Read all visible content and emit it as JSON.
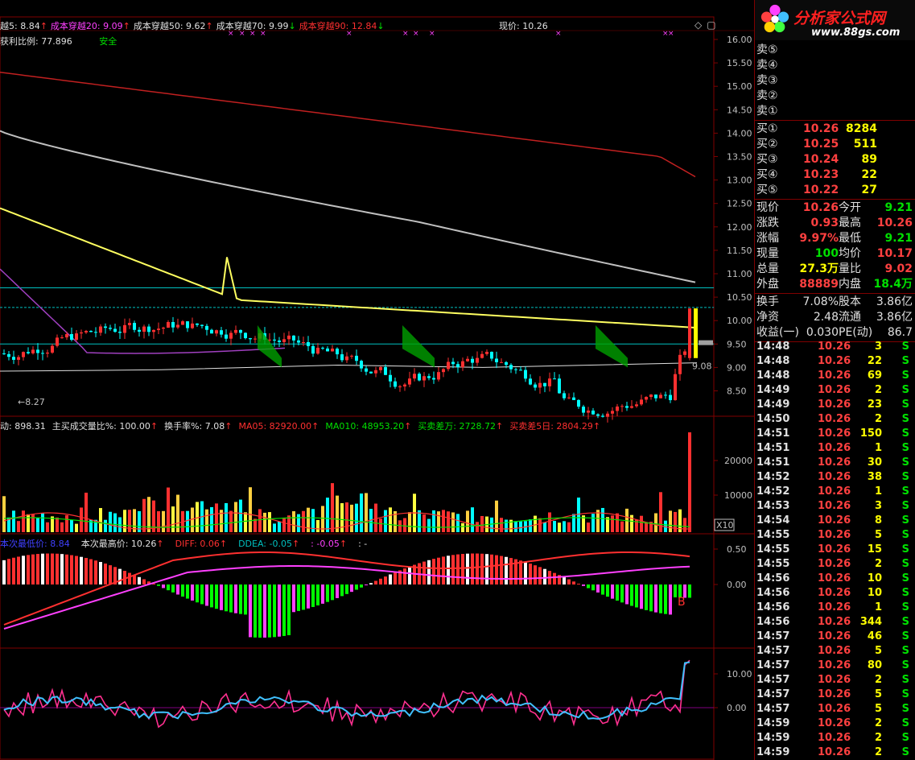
{
  "colors": {
    "bg": "#000000",
    "up": "#ff3030",
    "down": "#00ffff",
    "frame": "#800000",
    "yellow": "#ffff00",
    "green": "#00e000"
  },
  "main_header": {
    "items": [
      {
        "text": "越5: 8.84",
        "color": "#e0e0e0",
        "arrow": "↑",
        "arrow_color": "#ff3030"
      },
      {
        "text": "成本穿越20: 9.09",
        "color": "#ff40ff",
        "arrow": "↑",
        "arrow_color": "#ff3030"
      },
      {
        "text": "成本穿越50: 9.62",
        "color": "#e0e0e0",
        "arrow": "↑",
        "arrow_color": "#ff3030"
      },
      {
        "text": "成本穿越70: 9.99",
        "color": "#e0e0e0",
        "arrow": "↓",
        "arrow_color": "#00e000"
      },
      {
        "text": "成本穿越90: 12.84",
        "color": "#ff3030",
        "arrow": "↓",
        "arrow_color": "#00e000"
      }
    ],
    "current_price": "现价: 10.26",
    "profit_ratio": "获利比例: 77.896",
    "safe_label": "安全",
    "low_marker": "8.27",
    "right_marker": "9.08"
  },
  "price_axis": [
    "16.00",
    "15.50",
    "15.00",
    "14.50",
    "14.00",
    "13.50",
    "13.00",
    "12.50",
    "12.00",
    "11.50",
    "11.00",
    "10.50",
    "10.00",
    "9.50",
    "9.00",
    "8.50"
  ],
  "volume_header": {
    "items": [
      {
        "text": "动: 898.31",
        "color": "#e0e0e0"
      },
      {
        "text": "主买成交量比%: 100.00",
        "color": "#e0e0e0",
        "arrow": "↑",
        "arrow_color": "#ff3030"
      },
      {
        "text": "换手率%: 7.08",
        "color": "#e0e0e0",
        "arrow": "↑",
        "arrow_color": "#ff3030"
      },
      {
        "text": "MA05: 82920.00",
        "color": "#ff3030",
        "arrow": "↑",
        "arrow_color": "#ff3030"
      },
      {
        "text": "MA010: 48953.20",
        "color": "#00e000",
        "arrow": "↑",
        "arrow_color": "#ff3030"
      },
      {
        "text": "买卖差万: 2728.72",
        "color": "#00e000",
        "arrow": "↑",
        "arrow_color": "#ff3030"
      },
      {
        "text": "买卖差5日: 2804.29",
        "color": "#ff3030",
        "arrow": "↑",
        "arrow_color": "#ff3030"
      }
    ],
    "axis": [
      "20000",
      "10000"
    ],
    "unit": "X10"
  },
  "macd_header": {
    "items": [
      {
        "text": "本次最低价: 8.84",
        "color": "#4040ff"
      },
      {
        "text": "本次最高价: 10.26",
        "color": "#e0e0e0",
        "arrow": "↑",
        "arrow_color": "#ff3030"
      },
      {
        "text": "DIFF: 0.06",
        "color": "#ff3030",
        "arrow": "↑",
        "arrow_color": "#ff3030"
      },
      {
        "text": "DDEA: -0.05",
        "color": "#00c0c0",
        "arrow": "↑",
        "arrow_color": "#ff3030"
      },
      {
        "text": ": -0.05",
        "color": "#ff40ff",
        "arrow": "↑",
        "arrow_color": "#ff3030"
      },
      {
        "text": ": -",
        "color": "#e0e0e0"
      }
    ],
    "axis": [
      "0.50",
      "0.00"
    ],
    "marker": "B"
  },
  "kdj_axis": [
    "10.00",
    "0.00"
  ],
  "panel": {
    "brand": "分析家公式网",
    "url": "www.88gs.com",
    "sell": [
      {
        "label": "卖⑤",
        "price": "",
        "vol": ""
      },
      {
        "label": "卖④",
        "price": "",
        "vol": ""
      },
      {
        "label": "卖③",
        "price": "",
        "vol": ""
      },
      {
        "label": "卖②",
        "price": "",
        "vol": ""
      },
      {
        "label": "卖①",
        "price": "",
        "vol": ""
      }
    ],
    "buy": [
      {
        "label": "买①",
        "price": "10.26",
        "vol": "8284"
      },
      {
        "label": "买②",
        "price": "10.25",
        "vol": "511"
      },
      {
        "label": "买③",
        "price": "10.24",
        "vol": "89"
      },
      {
        "label": "买④",
        "price": "10.23",
        "vol": "22"
      },
      {
        "label": "买⑤",
        "price": "10.22",
        "vol": "27"
      }
    ],
    "stats": [
      {
        "l1": "现价",
        "v1": "10.26",
        "c1": "red",
        "l2": "今开",
        "v2": "9.21",
        "c2": "grn"
      },
      {
        "l1": "涨跌",
        "v1": "0.93",
        "c1": "red",
        "l2": "最高",
        "v2": "10.26",
        "c2": "red"
      },
      {
        "l1": "涨幅",
        "v1": "9.97%",
        "c1": "red",
        "l2": "最低",
        "v2": "9.21",
        "c2": "grn"
      },
      {
        "l1": "现量",
        "v1": "100",
        "c1": "grn",
        "l2": "均价",
        "v2": "10.17",
        "c2": "red"
      },
      {
        "l1": "总量",
        "v1": "27.3万",
        "c1": "yel",
        "l2": "量比",
        "v2": "9.02",
        "c2": "red"
      },
      {
        "l1": "外盘",
        "v1": "88889",
        "c1": "red",
        "l2": "内盘",
        "v2": "18.4万",
        "c2": "grn"
      }
    ],
    "fund": [
      {
        "l1": "换手",
        "v1": "7.08%",
        "l2": "股本",
        "v2": "3.86亿"
      },
      {
        "l1": "净资",
        "v1": "2.48",
        "l2": "流通",
        "v2": "3.86亿"
      },
      {
        "l1": "收益(一)",
        "v1": "0.030",
        "l2": "PE(动)",
        "v2": "86.7"
      }
    ],
    "ticks": [
      {
        "time": "14:48",
        "price": "10.26",
        "vol": "3",
        "side": "S"
      },
      {
        "time": "14:48",
        "price": "10.26",
        "vol": "22",
        "side": "S"
      },
      {
        "time": "14:48",
        "price": "10.26",
        "vol": "69",
        "side": "S"
      },
      {
        "time": "14:49",
        "price": "10.26",
        "vol": "2",
        "side": "S"
      },
      {
        "time": "14:49",
        "price": "10.26",
        "vol": "23",
        "side": "S"
      },
      {
        "time": "14:50",
        "price": "10.26",
        "vol": "2",
        "side": "S"
      },
      {
        "time": "14:51",
        "price": "10.26",
        "vol": "150",
        "side": "S"
      },
      {
        "time": "14:51",
        "price": "10.26",
        "vol": "1",
        "side": "S"
      },
      {
        "time": "14:51",
        "price": "10.26",
        "vol": "30",
        "side": "S"
      },
      {
        "time": "14:52",
        "price": "10.26",
        "vol": "38",
        "side": "S"
      },
      {
        "time": "14:52",
        "price": "10.26",
        "vol": "1",
        "side": "S"
      },
      {
        "time": "14:53",
        "price": "10.26",
        "vol": "3",
        "side": "S"
      },
      {
        "time": "14:54",
        "price": "10.26",
        "vol": "8",
        "side": "S"
      },
      {
        "time": "14:55",
        "price": "10.26",
        "vol": "5",
        "side": "S"
      },
      {
        "time": "14:55",
        "price": "10.26",
        "vol": "15",
        "side": "S"
      },
      {
        "time": "14:55",
        "price": "10.26",
        "vol": "2",
        "side": "S"
      },
      {
        "time": "14:56",
        "price": "10.26",
        "vol": "10",
        "side": "S"
      },
      {
        "time": "14:56",
        "price": "10.26",
        "vol": "10",
        "side": "S"
      },
      {
        "time": "14:56",
        "price": "10.26",
        "vol": "1",
        "side": "S"
      },
      {
        "time": "14:56",
        "price": "10.26",
        "vol": "344",
        "side": "S"
      },
      {
        "time": "14:57",
        "price": "10.26",
        "vol": "46",
        "side": "S"
      },
      {
        "time": "14:57",
        "price": "10.26",
        "vol": "5",
        "side": "S"
      },
      {
        "time": "14:57",
        "price": "10.26",
        "vol": "80",
        "side": "S"
      },
      {
        "time": "14:57",
        "price": "10.26",
        "vol": "2",
        "side": "S"
      },
      {
        "time": "14:57",
        "price": "10.26",
        "vol": "5",
        "side": "S"
      },
      {
        "time": "14:57",
        "price": "10.26",
        "vol": "5",
        "side": "S"
      },
      {
        "time": "14:59",
        "price": "10.26",
        "vol": "2",
        "side": "S"
      },
      {
        "time": "14:59",
        "price": "10.26",
        "vol": "2",
        "side": "S"
      },
      {
        "time": "14:59",
        "price": "10.26",
        "vol": "2",
        "side": "S"
      }
    ]
  }
}
